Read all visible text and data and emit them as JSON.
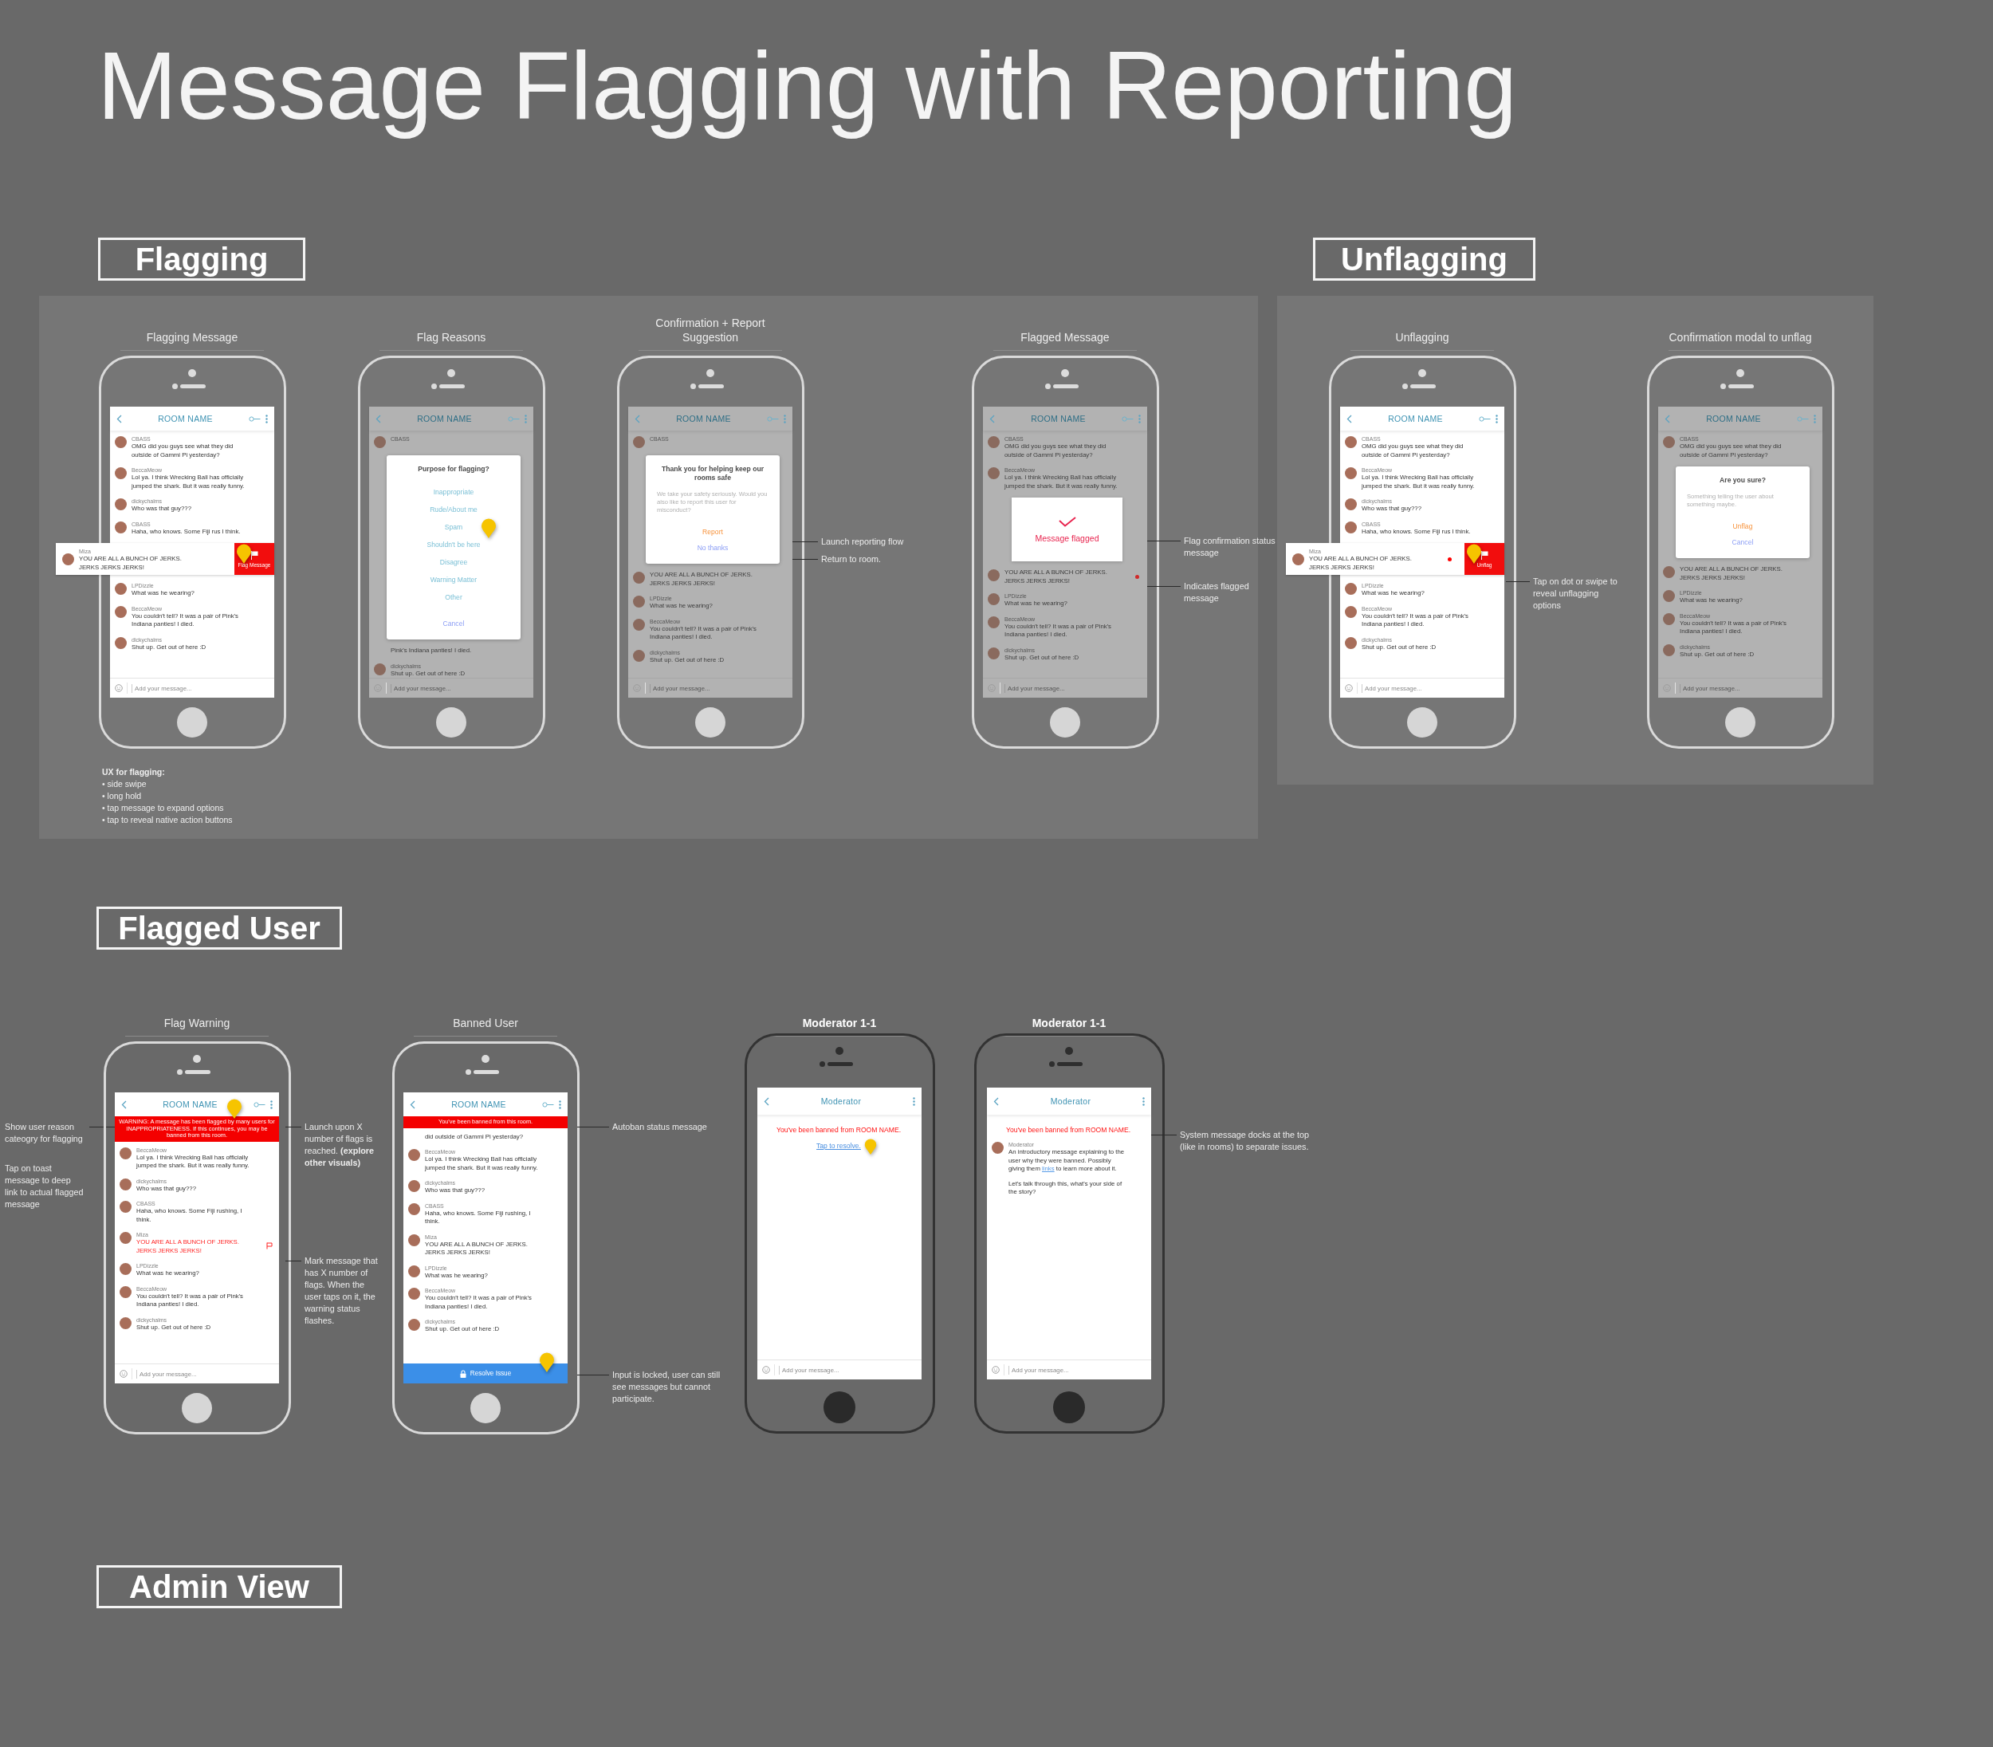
{
  "title": "Message Flagging with Reporting",
  "sections": [
    {
      "kind": "panel",
      "heading": "Flagging",
      "screens": [
        {
          "title": "Flagging Message",
          "kind": "light",
          "dimmed": false,
          "header": {
            "kind": "room",
            "title": "ROOM NAME"
          },
          "items": [
            {
              "kind": "message",
              "name": "CBASS",
              "text": "OMG did you guys see what they did outside of Gammi Pi yesterday?"
            },
            {
              "kind": "message",
              "name": "BeccaMeow",
              "text": "Lol ya. I think Wrecking Ball has officially jumped the shark. But it was really funny."
            },
            {
              "kind": "message",
              "name": "dickychalms",
              "text": "Who was that guy???"
            },
            {
              "kind": "message",
              "name": "CBASS",
              "text": "Haha, who knows. Some Fiji rus I think."
            },
            {
              "kind": "swiped",
              "name": "Miza",
              "text": "YOU ARE ALL A BUNCH OF JERKS. JERKS JERKS JERKS!",
              "action": "Flag Message",
              "dot": false,
              "touch": true
            },
            {
              "kind": "message",
              "name": "LPDizzle",
              "text": "What was he wearing?"
            },
            {
              "kind": "message",
              "name": "BeccaMeow",
              "text": "You couldn't tell? It was a pair of Pink's Indiana panties! I died."
            },
            {
              "kind": "message",
              "name": "dickychalms",
              "text": "Shut up. Get out of here :D"
            }
          ],
          "footer": {
            "kind": "input",
            "placeholder": "Add your message..."
          },
          "ux_notes": {
            "title": "UX for flagging:",
            "items": [
              "• side swipe",
              "• long hold",
              "• tap message to expand options",
              "• tap to reveal native action buttons"
            ]
          }
        },
        {
          "title": "Flag Reasons",
          "kind": "light",
          "dimmed": true,
          "header": {
            "kind": "room",
            "title": "ROOM NAME"
          },
          "items": [
            {
              "kind": "message",
              "name": "CBASS"
            },
            {
              "kind": "modal",
              "title": "Purpose for flagging?",
              "options": [
                {
                  "label": "Inappropriate",
                  "kind": "option",
                  "touch": false
                },
                {
                  "label": "Rude/About me",
                  "kind": "option",
                  "touch": false
                },
                {
                  "label": "Spam",
                  "kind": "option",
                  "touch": true
                },
                {
                  "label": "Shouldn't be here",
                  "kind": "option",
                  "touch": false
                },
                {
                  "label": "Disagree",
                  "kind": "option",
                  "touch": false
                },
                {
                  "label": "Warning Matter",
                  "kind": "option",
                  "touch": false
                },
                {
                  "label": "Other",
                  "kind": "option",
                  "touch": false
                },
                {
                  "label": "Cancel",
                  "kind": "cancel",
                  "touch": false
                }
              ]
            },
            {
              "kind": "fragment",
              "text": "Pink's Indiana panties! I died."
            },
            {
              "kind": "message",
              "name": "dickychalms",
              "text": "Shut up. Get out of here :D"
            }
          ],
          "footer": {
            "kind": "input",
            "placeholder": "Add your message..."
          }
        },
        {
          "title": "Confirmation + Report Suggestion",
          "kind": "light",
          "dimmed": true,
          "header": {
            "kind": "room",
            "title": "ROOM NAME"
          },
          "items": [
            {
              "kind": "message",
              "name": "CBASS"
            },
            {
              "kind": "modal",
              "title": "Thank you for helping keep our rooms safe",
              "body": "We take your safety seriously. Would you also like to report this user for misconduct?",
              "options": [
                {
                  "label": "Report",
                  "kind": "accent",
                  "touch": false
                },
                {
                  "label": "No thanks",
                  "kind": "cancel",
                  "touch": false
                }
              ]
            },
            {
              "kind": "message",
              "text": "YOU ARE ALL A BUNCH OF JERKS. JERKS JERKS JERKS!"
            },
            {
              "kind": "message",
              "name": "LPDizzle",
              "text": "What was he wearing?"
            },
            {
              "kind": "message",
              "name": "BeccaMeow",
              "text": "You couldn't tell? It was a pair of Pink's Indiana panties! I died."
            },
            {
              "kind": "message",
              "name": "dickychalms",
              "text": "Shut up. Get out of here :D"
            }
          ],
          "footer": {
            "kind": "input",
            "placeholder": "Add your message..."
          },
          "notes_right": [
            {
              "text": "Launch reporting flow",
              "leader": true
            },
            {
              "text": "Return to room.",
              "leader": true
            }
          ]
        },
        {
          "title": "Flagged Message",
          "kind": "light",
          "dimmed": true,
          "header": {
            "kind": "room",
            "title": "ROOM NAME"
          },
          "items": [
            {
              "kind": "message",
              "name": "CBASS",
              "text": "OMG did you guys see what they did outside of Gammi Pi yesterday?"
            },
            {
              "kind": "message",
              "name": "BeccaMeow",
              "text": "Lol ya. I think Wrecking Ball has officially jumped the shark. But it was really funny."
            },
            {
              "kind": "toast",
              "text": "Message flagged"
            },
            {
              "kind": "flagged",
              "text": "YOU ARE ALL A BUNCH OF JERKS. JERKS JERKS JERKS!"
            },
            {
              "kind": "message",
              "name": "LPDizzle",
              "text": "What was he wearing?"
            },
            {
              "kind": "message",
              "name": "BeccaMeow",
              "text": "You couldn't tell? It was a pair of Pink's Indiana panties! I died."
            },
            {
              "kind": "message",
              "name": "dickychalms",
              "text": "Shut up. Get out of here :D"
            }
          ],
          "footer": {
            "kind": "input",
            "placeholder": "Add your message..."
          },
          "notes_right": [
            {
              "text": "Flag confirmation status message",
              "leader": true
            },
            {
              "text": "Indicates flagged message",
              "leader": true
            }
          ]
        }
      ]
    },
    {
      "kind": "panel",
      "heading": "Unflagging",
      "screens": [
        {
          "title": "Unflagging",
          "kind": "light",
          "dimmed": false,
          "header": {
            "kind": "room",
            "title": "ROOM NAME"
          },
          "items": [
            {
              "kind": "message",
              "name": "CBASS",
              "text": "OMG did you guys see what they did outside of Gammi Pi yesterday?"
            },
            {
              "kind": "message",
              "name": "BeccaMeow",
              "text": "Lol ya. I think Wrecking Ball has officially jumped the shark. But it was really funny."
            },
            {
              "kind": "message",
              "name": "dickychalms",
              "text": "Who was that guy???"
            },
            {
              "kind": "message",
              "name": "CBASS",
              "text": "Haha, who knows. Some Fiji rus I think."
            },
            {
              "kind": "swiped",
              "name": "Miza",
              "text": "YOU ARE ALL A BUNCH OF JERKS. JERKS JERKS JERKS!",
              "action": "Unflag",
              "dot": true,
              "touch": true
            },
            {
              "kind": "message",
              "name": "LPDizzle",
              "text": "What was he wearing?"
            },
            {
              "kind": "message",
              "name": "BeccaMeow",
              "text": "You couldn't tell? It was a pair of Pink's Indiana panties! I died."
            },
            {
              "kind": "message",
              "name": "dickychalms",
              "text": "Shut up. Get out of here :D"
            }
          ],
          "footer": {
            "kind": "input",
            "placeholder": "Add your message..."
          },
          "notes_right": [
            {
              "text": "Tap on dot or swipe to reveal unflagging options",
              "leader": true
            }
          ]
        },
        {
          "title": "Confirmation modal to unflag",
          "kind": "light",
          "dimmed": true,
          "header": {
            "kind": "room",
            "title": "ROOM NAME"
          },
          "items": [
            {
              "kind": "message",
              "name": "CBASS",
              "text": "OMG did you guys see what they did outside of Gammi Pi yesterday?"
            },
            {
              "kind": "modal",
              "title": "Are you sure?",
              "body": "Something telling the user about something maybe.",
              "options": [
                {
                  "label": "Unflag",
                  "kind": "accent",
                  "touch": false
                },
                {
                  "label": "Cancel",
                  "kind": "cancel",
                  "touch": false
                }
              ]
            },
            {
              "kind": "message",
              "text": "YOU ARE ALL A BUNCH OF JERKS. JERKS JERKS JERKS!"
            },
            {
              "kind": "message",
              "name": "LPDizzle",
              "text": "What was he wearing?"
            },
            {
              "kind": "message",
              "name": "BeccaMeow",
              "text": "You couldn't tell? It was a pair of Pink's Indiana panties! I died."
            },
            {
              "kind": "message",
              "name": "dickychalms",
              "text": "Shut up. Get out of here :D"
            }
          ],
          "footer": {
            "kind": "input",
            "placeholder": "Add your message..."
          }
        }
      ]
    },
    {
      "kind": "open",
      "heading": "Flagged User",
      "screens": [
        {
          "title": "Flag Warning",
          "kind": "light",
          "dimmed": false,
          "header": {
            "kind": "room",
            "title": "ROOM NAME"
          },
          "banner": {
            "text": "WARNING: A message has been flagged by many users for INAPPROPRIATENESS. If this continues, you may be banned from this room.",
            "touch": true
          },
          "items": [
            {
              "kind": "message",
              "name": "BeccaMeow",
              "text": "Lol ya. I think Wrecking Ball has officially jumped the shark. But it was really funny."
            },
            {
              "kind": "message",
              "name": "dickychalms",
              "text": "Who was that guy???"
            },
            {
              "kind": "message",
              "name": "CBASS",
              "text": "Haha, who knows. Some Fiji rushing, I think."
            },
            {
              "kind": "warned",
              "name": "Miza",
              "text": "YOU ARE ALL A BUNCH OF JERKS. JERKS JERKS JERKS!"
            },
            {
              "kind": "message",
              "name": "LPDizzle",
              "text": "What was he wearing?"
            },
            {
              "kind": "message",
              "name": "BeccaMeow",
              "text": "You couldn't tell? It was a pair of Pink's Indiana panties! I died."
            },
            {
              "kind": "message",
              "name": "dickychalms",
              "text": "Shut up. Get out of here :D"
            }
          ],
          "footer": {
            "kind": "input",
            "placeholder": "Add your message..."
          },
          "notes_left": [
            {
              "text": "Show user reason cateogry for flagging",
              "leader": true
            },
            {
              "text": "Tap on toast message to deep link to actual flagged message",
              "leader": false
            }
          ],
          "notes_right": [
            {
              "text": "Launch upon X number of flags is reached. **(explore other visuals)**",
              "leader": true
            },
            {
              "text": "Mark message that has X number of flags. When the user taps on it, the warning status flashes.",
              "leader": true
            }
          ]
        },
        {
          "title": "Banned User",
          "kind": "light",
          "dimmed": false,
          "header": {
            "kind": "room",
            "title": "ROOM NAME"
          },
          "banner": {
            "text": "You've been banned from this room.",
            "touch": false
          },
          "items": [
            {
              "kind": "fragment",
              "text": "did outside of Gammi Pi yesterday?"
            },
            {
              "kind": "message",
              "name": "BeccaMeow",
              "text": "Lol ya. I think Wrecking Ball has officially jumped the shark. But it was really funny."
            },
            {
              "kind": "message",
              "name": "dickychalms",
              "text": "Who was that guy???"
            },
            {
              "kind": "message",
              "name": "CBASS",
              "text": "Haha, who knows. Some Fiji rushing, I think."
            },
            {
              "kind": "message",
              "name": "Miza",
              "text": "YOU ARE ALL A BUNCH OF JERKS. JERKS JERKS JERKS!"
            },
            {
              "kind": "message",
              "name": "LPDizzle",
              "text": "What was he wearing?"
            },
            {
              "kind": "message",
              "name": "BeccaMeow",
              "text": "You couldn't tell? It was a pair of Pink's Indiana panties! I died."
            },
            {
              "kind": "message",
              "name": "dickychalms",
              "text": "Shut up. Get out of here :D"
            }
          ],
          "footer": {
            "kind": "locked",
            "label": "Resolve Issue",
            "touch": true
          },
          "notes_right": [
            {
              "text": "Autoban status message",
              "leader": true
            },
            {
              "text": "Input is locked, user can still see messages but cannot participate.",
              "leader": true
            }
          ]
        },
        {
          "title": "Moderator 1-1",
          "kind": "dark",
          "dimmed": false,
          "header": {
            "kind": "direct",
            "title": "Moderator"
          },
          "items": [
            {
              "kind": "system",
              "text": "You've been banned from ROOM NAME.",
              "link": "Tap to resolve.",
              "touch": true
            }
          ],
          "footer": {
            "kind": "input",
            "placeholder": "Add your message..."
          }
        },
        {
          "title": "Moderator 1-1",
          "kind": "dark",
          "dimmed": false,
          "header": {
            "kind": "direct",
            "title": "Moderator"
          },
          "items": [
            {
              "kind": "system",
              "text": "You've been banned from ROOM NAME.",
              "touch": false
            },
            {
              "kind": "linked",
              "name": "Moderator",
              "before": "An introductory message explaining to the user why they were banned. Possibly giving them ",
              "link": "links",
              "after": " to learn more about it.",
              "more": "Let's talk through this, what's your side of the story?"
            }
          ],
          "footer": {
            "kind": "input",
            "placeholder": "Add your message..."
          },
          "notes_right": [
            {
              "text": "System message docks at the top (like in rooms) to separate issues.",
              "leader": true
            }
          ]
        }
      ]
    },
    {
      "kind": "open",
      "heading": "Admin View"
    }
  ]
}
